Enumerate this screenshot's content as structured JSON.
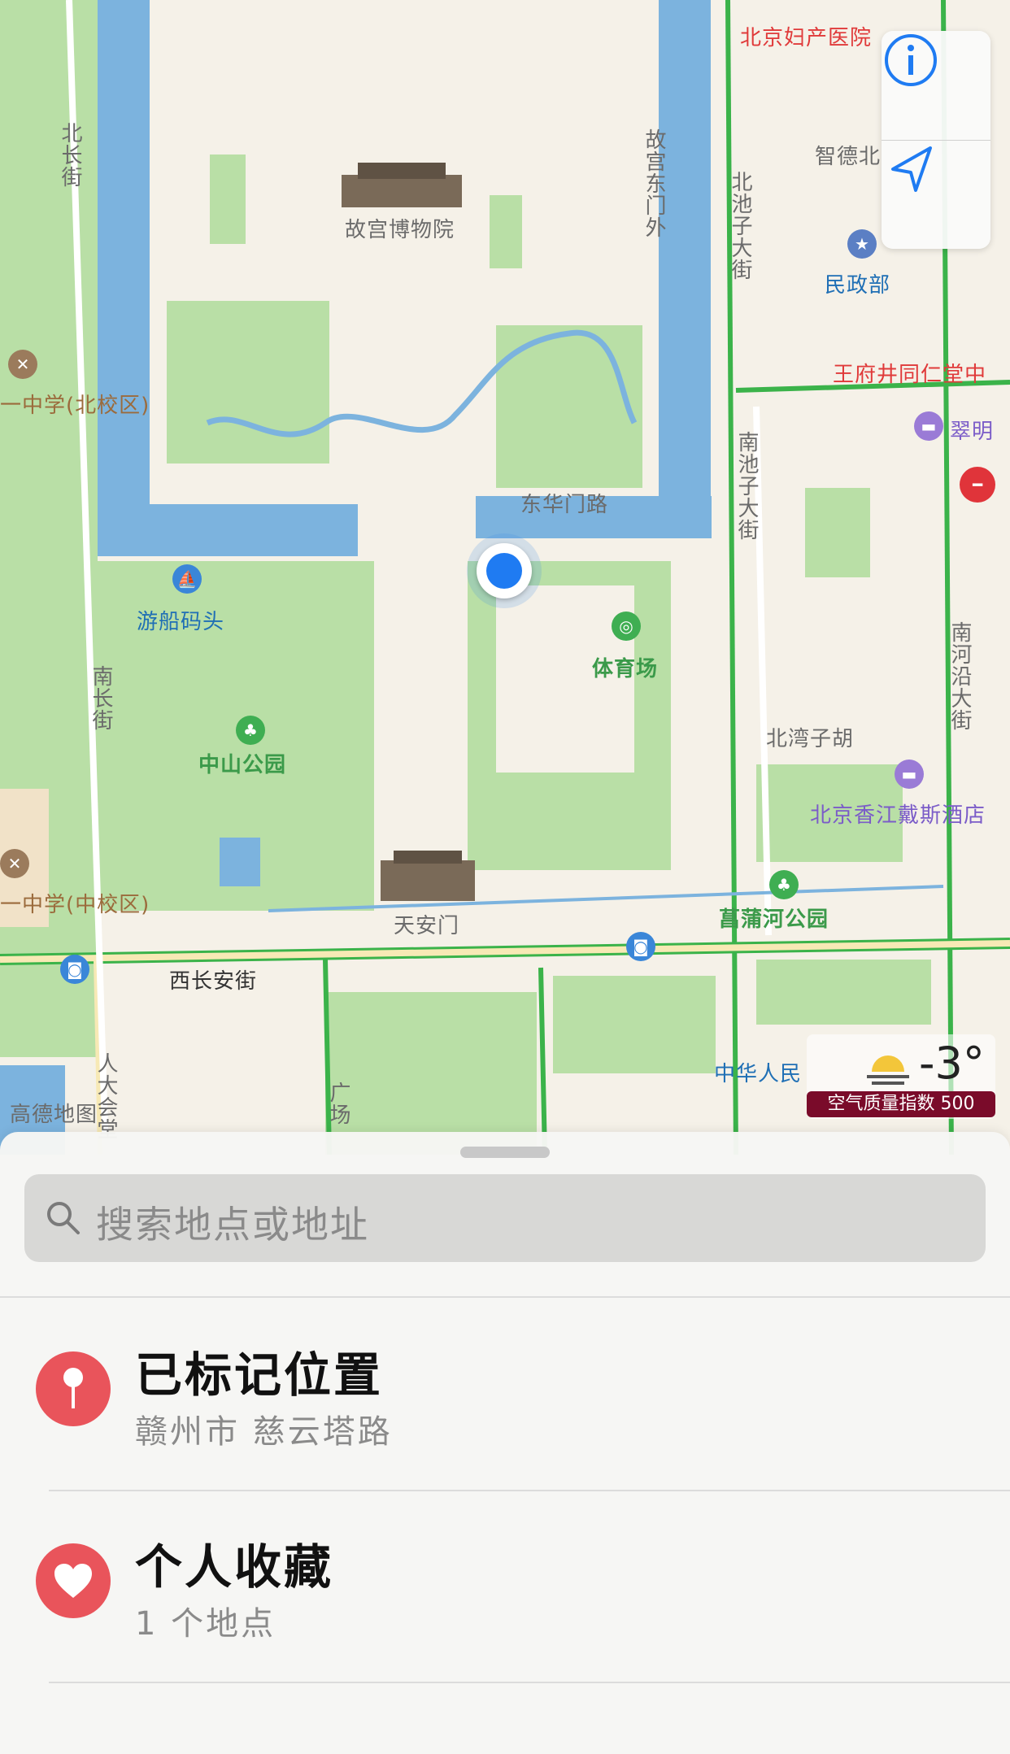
{
  "map": {
    "labels": {
      "hospital": "北京妇产医院",
      "north_changjie": "北长街",
      "forbidden_city": "故宫博物院",
      "gugong_dongmen": "故宫东门外",
      "beichizi": "北池子大街",
      "zhide": "智德北",
      "minzhengbu": "民政部",
      "school_north": "一中学(北校区)",
      "tongrentang": "王府井同仁堂中",
      "cuiming": "翠明",
      "donghuamen": "东华门路",
      "nanchizi": "南池子大街",
      "boat_dock": "游船码头",
      "stadium": "体育场",
      "south_changjie": "南长街",
      "beiwan": "北湾子胡",
      "nanheyan": "南河沿大街",
      "zhongshan_park": "中山公园",
      "shangri_hotel": "北京香江戴斯酒店",
      "school_mid": "一中学(中校区)",
      "tiananmen": "天安门",
      "changpu_park": "菖蒲河公园",
      "west_changan": "西长安街",
      "zhonghua": "中华人民",
      "renda": "人大会堂",
      "guangchang": "广场",
      "gaode": "高德地图"
    }
  },
  "controls": {
    "info_icon": "info-icon",
    "locate_icon": "location-arrow-icon"
  },
  "weather": {
    "temperature": "-3°",
    "aqi_label": "空气质量指数 500"
  },
  "sheet": {
    "search_placeholder": "搜索地点或地址",
    "items": [
      {
        "title": "已标记位置",
        "subtitle": "赣州市 慈云塔路",
        "icon": "pin-icon",
        "color": "#e9545b"
      },
      {
        "title": "个人收藏",
        "subtitle": "1 个地点",
        "icon": "heart-icon",
        "color": "#e9545b"
      }
    ]
  }
}
